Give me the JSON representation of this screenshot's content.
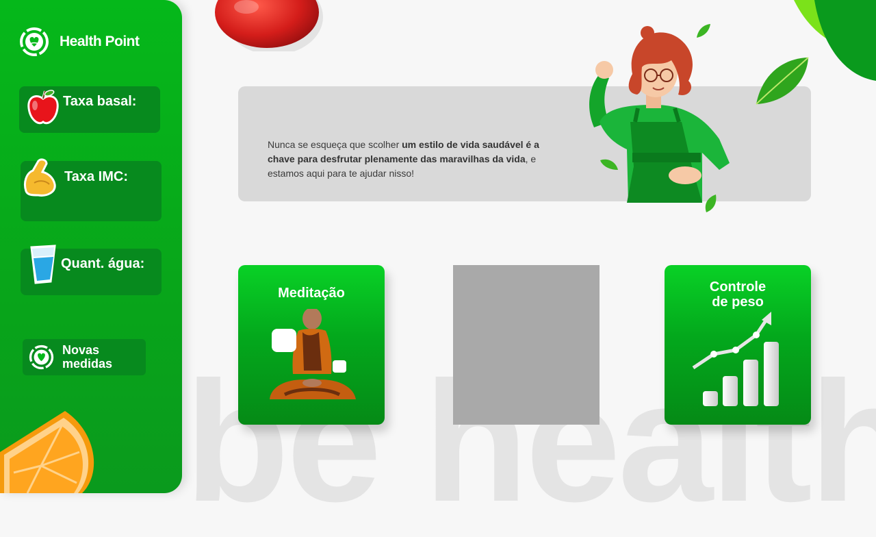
{
  "app": {
    "name": "Health Point"
  },
  "sidebar": {
    "stats": [
      {
        "label": "Taxa basal:",
        "icon": "apple-icon"
      },
      {
        "label": "Taxa IMC:",
        "icon": "flexed-biceps-icon"
      },
      {
        "label": "Quant. água:",
        "icon": "water-glass-icon"
      }
    ],
    "new_button": {
      "label_line1": "Novas",
      "label_line2": "medidas",
      "icon": "health-point-logo-icon"
    }
  },
  "message": {
    "part1": "Nunca se esqueça que scolher ",
    "bold": "um estilo de vida saudável é a chave para desfrutar plenamente das maravilhas da vida",
    "part2": ", e estamos aqui para te ajudar nisso!"
  },
  "cards": [
    {
      "title": "Meditação",
      "icon": "meditating-monk-image"
    },
    {
      "title": "",
      "icon": "placeholder-image"
    },
    {
      "title_line1": "Controle",
      "title_line2": "de peso",
      "icon": "growth-chart-icon"
    }
  ],
  "background": {
    "watermark": "be health"
  },
  "colors": {
    "brand_green": "#05b81a",
    "card_dark_green": "#078a1e",
    "panel_gray": "#d9d9d9"
  }
}
